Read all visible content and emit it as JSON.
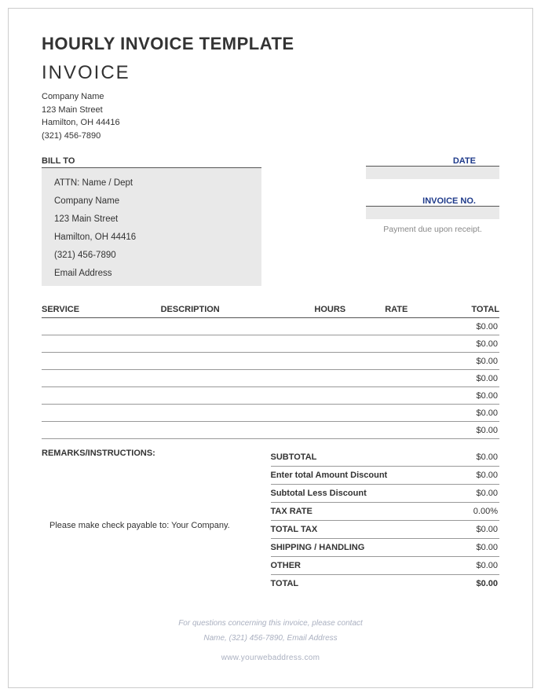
{
  "title_main": "HOURLY INVOICE TEMPLATE",
  "title_invoice": "INVOICE",
  "company": {
    "name": "Company Name",
    "street": "123 Main Street",
    "citystate": "Hamilton, OH 44416",
    "phone": "(321) 456-7890"
  },
  "bill_to_label": "BILL TO",
  "bill_to": {
    "attn": "ATTN: Name / Dept",
    "company": "Company Name",
    "street": "123 Main Street",
    "citystate": "Hamilton, OH  44416",
    "phone": "(321) 456-7890",
    "email": "Email Address"
  },
  "meta": {
    "date_label": "DATE",
    "invoice_no_label": "INVOICE NO.",
    "payment_note": "Payment due upon receipt."
  },
  "table": {
    "headers": {
      "service": "SERVICE",
      "description": "DESCRIPTION",
      "hours": "HOURS",
      "rate": "RATE",
      "total": "TOTAL"
    },
    "rows": [
      {
        "total": "$0.00"
      },
      {
        "total": "$0.00"
      },
      {
        "total": "$0.00"
      },
      {
        "total": "$0.00"
      },
      {
        "total": "$0.00"
      },
      {
        "total": "$0.00"
      },
      {
        "total": "$0.00"
      }
    ]
  },
  "remarks_label": "REMARKS/INSTRUCTIONS:",
  "payable_note": "Please make check payable to: Your Company.",
  "totals": {
    "subtotal": {
      "label": "SUBTOTAL",
      "value": "$0.00"
    },
    "discount": {
      "label": "Enter total Amount Discount",
      "value": "$0.00"
    },
    "less_discount": {
      "label": "Subtotal Less Discount",
      "value": "$0.00"
    },
    "tax_rate": {
      "label": "TAX RATE",
      "value": "0.00%"
    },
    "total_tax": {
      "label": "TOTAL TAX",
      "value": "$0.00"
    },
    "shipping": {
      "label": "SHIPPING / HANDLING",
      "value": "$0.00"
    },
    "other": {
      "label": "OTHER",
      "value": "$0.00"
    },
    "total": {
      "label": "TOTAL",
      "value": "$0.00"
    }
  },
  "footer": {
    "line1": "For questions concerning this invoice, please contact",
    "line2": "Name, (321) 456-7890, Email Address",
    "web": "www.yourwebaddress.com"
  }
}
